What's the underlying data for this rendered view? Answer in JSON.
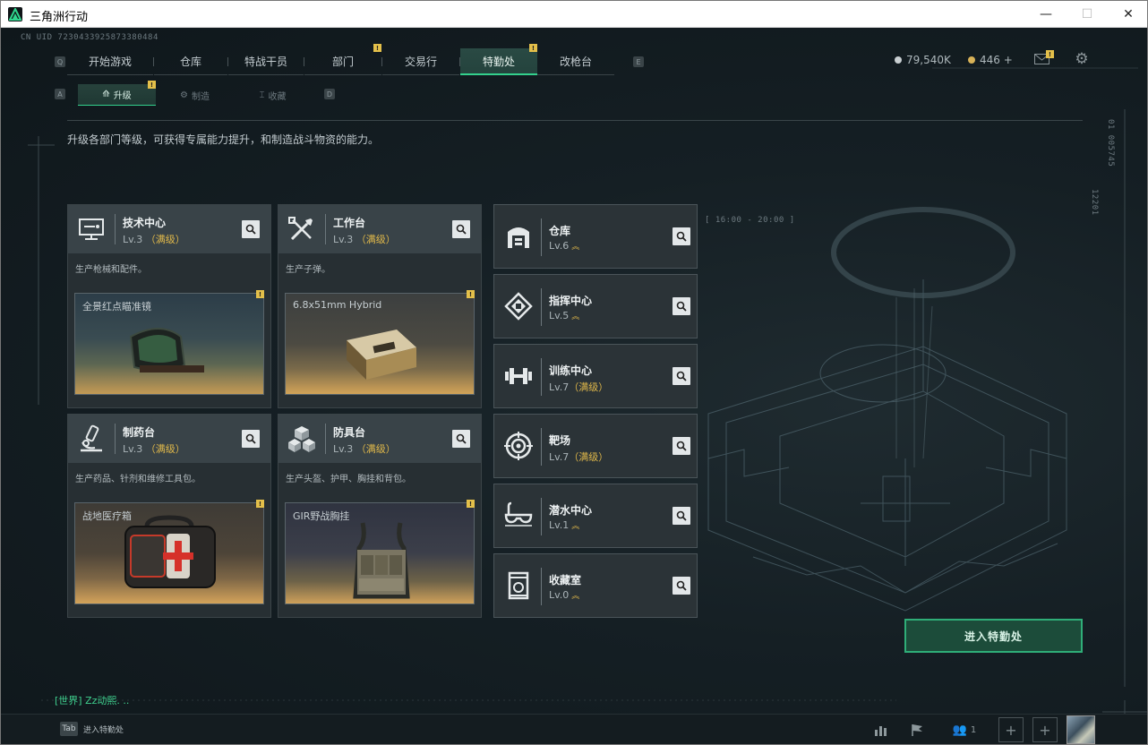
{
  "window": {
    "title": "三角洲行动",
    "min": "—",
    "max": "☐",
    "close": "✕"
  },
  "cnuid": "CN UID 7230433925873380484",
  "nav": {
    "left_key": "Q",
    "right_key": "E",
    "tabs": [
      {
        "label": "开始游戏",
        "active": false,
        "badge": ""
      },
      {
        "label": "仓库",
        "active": false,
        "badge": ""
      },
      {
        "label": "特战干员",
        "active": false,
        "badge": ""
      },
      {
        "label": "部门",
        "active": false,
        "badge": "!"
      },
      {
        "label": "交易行",
        "active": false,
        "badge": ""
      },
      {
        "label": "特勤处",
        "active": true,
        "badge": "!"
      },
      {
        "label": "改枪台",
        "active": false,
        "badge": ""
      }
    ]
  },
  "subnav": {
    "left_key": "A",
    "right_key": "D",
    "tabs": [
      {
        "label": "升级",
        "active": true,
        "badge": "!",
        "icon": "upgrade-icon"
      },
      {
        "label": "制造",
        "active": false,
        "badge": "",
        "icon": "craft-icon"
      },
      {
        "label": "收藏",
        "active": false,
        "badge": "",
        "icon": "collection-icon"
      }
    ]
  },
  "currency": {
    "silver": "79,540K",
    "gold": "446 +"
  },
  "mail_badge": "!",
  "description": "升级各部门等级，可获得专属能力提升，和制造战斗物资的能力。",
  "side_codes": {
    "a": "01 005745",
    "b": "12201"
  },
  "range_label": "[ 16:00 - 20:00 ]",
  "cards": [
    {
      "name": "技术中心",
      "level": "Lv.3",
      "max": "（满级）",
      "desc": "生产枪械和配件。",
      "item": "全景红点瞄准镜",
      "badge": "!",
      "icon": "computer-icon"
    },
    {
      "name": "工作台",
      "level": "Lv.3",
      "max": "（满级）",
      "desc": "生产子弹。",
      "item": "6.8x51mm Hybrid",
      "badge": "!",
      "icon": "tools-icon"
    },
    {
      "name": "制药台",
      "level": "Lv.3",
      "max": "（满级）",
      "desc": "生产药品、针剂和维修工具包。",
      "item": "战地医疗箱",
      "badge": "!",
      "icon": "microscope-icon"
    },
    {
      "name": "防具台",
      "level": "Lv.3",
      "max": "（满级）",
      "desc": "生产头盔、护甲、胸挂和背包。",
      "item": "GIR野战胸挂",
      "badge": "!",
      "icon": "armor-blocks-icon"
    }
  ],
  "stations": [
    {
      "name": "仓库",
      "level": "Lv.6",
      "max": "",
      "upgradable": true,
      "icon": "warehouse-icon"
    },
    {
      "name": "指挥中心",
      "level": "Lv.5",
      "max": "",
      "upgradable": true,
      "icon": "command-chip-icon"
    },
    {
      "name": "训练中心",
      "level": "Lv.7",
      "max": "（满级）",
      "upgradable": false,
      "icon": "dumbbell-icon"
    },
    {
      "name": "靶场",
      "level": "Lv.7",
      "max": "（满级）",
      "upgradable": false,
      "icon": "target-icon"
    },
    {
      "name": "潜水中心",
      "level": "Lv.1",
      "max": "",
      "upgradable": true,
      "icon": "diving-mask-icon"
    },
    {
      "name": "收藏室",
      "level": "Lv.0",
      "max": "",
      "upgradable": true,
      "icon": "collection-room-icon"
    }
  ],
  "enter_button": "进入特勤处",
  "chat": "[世界] Zz动熙. ..",
  "bottom": {
    "tab_key": "Tab",
    "tab_label": "进入特勤处",
    "friends_count": "1"
  }
}
